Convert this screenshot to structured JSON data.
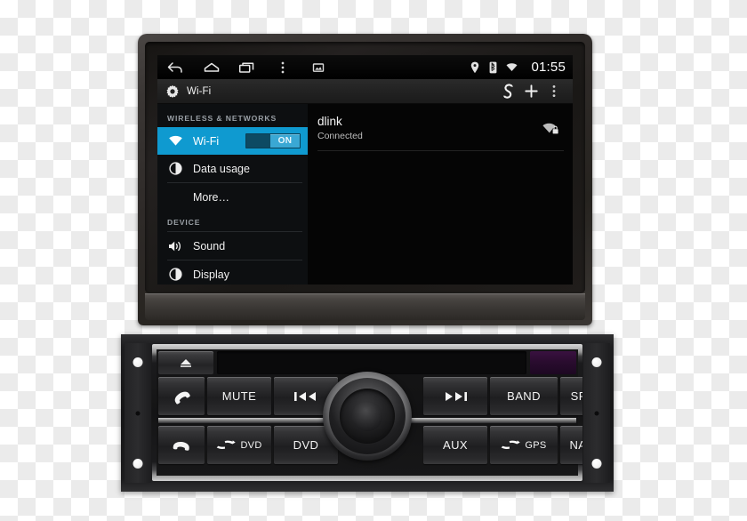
{
  "device": {
    "monitor_label": "7-inch android car head unit touchscreen",
    "headunit_label": "double-din car stereo front panel"
  },
  "screen": {
    "navbar": {
      "back_icon": "back-arrow-icon",
      "home_icon": "home-icon",
      "recents_icon": "recent-apps-icon",
      "menu_icon": "overflow-menu-icon",
      "screenshot_icon": "screenshot-icon",
      "status": {
        "location_icon": "location-pin-icon",
        "bluetooth_icon": "bluetooth-icon",
        "wifi_icon": "wifi-signal-icon",
        "clock": "01:55"
      }
    },
    "actionbar": {
      "app_icon": "settings-gear-icon",
      "title": "Wi-Fi",
      "scan_icon": "wifi-scan-icon",
      "add_icon": "add-network-icon",
      "overflow_icon": "overflow-menu-icon"
    },
    "settings_list": {
      "sections": [
        {
          "header": "WIRELESS & NETWORKS",
          "items": [
            {
              "label": "Wi-Fi",
              "icon": "wifi-icon",
              "selected": true,
              "toggle": "ON"
            },
            {
              "label": "Data usage",
              "icon": "data-usage-icon",
              "selected": false
            },
            {
              "label": "More…",
              "icon": "",
              "selected": false
            }
          ]
        },
        {
          "header": "DEVICE",
          "items": [
            {
              "label": "Sound",
              "icon": "sound-icon",
              "selected": false
            },
            {
              "label": "Display",
              "icon": "display-icon",
              "selected": false
            }
          ]
        }
      ]
    },
    "networks": [
      {
        "ssid": "dlink",
        "status": "Connected",
        "signal_icon": "wifi-secured-icon"
      }
    ],
    "colors": {
      "accent": "#0f9ad0",
      "toggle_thumb": "#3aa8d4",
      "screen_bg": "#000000",
      "list_bg": "#0d0f11",
      "section_text": "#9aa0a6"
    }
  },
  "headunit": {
    "eject_icon": "eject-icon",
    "disc_slot": "disc-slot",
    "ir_window": "ir-receiver-window",
    "ir_color": "#2a0c2f",
    "knob": "volume-rotary-knob",
    "buttons_top": [
      {
        "name": "call-answer",
        "label": "",
        "icon": "phone-answer-icon"
      },
      {
        "name": "mute",
        "label": "MUTE",
        "icon": ""
      },
      {
        "name": "previous-track",
        "label": "",
        "icon": "previous-track-icon"
      },
      {
        "name": "next-track",
        "label": "",
        "icon": "next-track-icon"
      },
      {
        "name": "band",
        "label": "BAND",
        "icon": ""
      },
      {
        "name": "source",
        "label": "SRC",
        "icon": ""
      }
    ],
    "buttons_bottom": [
      {
        "name": "call-end",
        "label": "",
        "icon": "phone-end-icon"
      },
      {
        "name": "sd-dvd",
        "label": "DVD",
        "icon": "sd-card-logo"
      },
      {
        "name": "dvd",
        "label": "DVD",
        "icon": ""
      },
      {
        "name": "aux",
        "label": "AUX",
        "icon": ""
      },
      {
        "name": "sd-gps",
        "label": "GPS",
        "icon": "sd-card-logo"
      },
      {
        "name": "navi",
        "label": "NAVI",
        "icon": ""
      }
    ],
    "screws": [
      "screw-top-left",
      "screw-bottom-left",
      "screw-top-right",
      "screw-bottom-right"
    ]
  }
}
